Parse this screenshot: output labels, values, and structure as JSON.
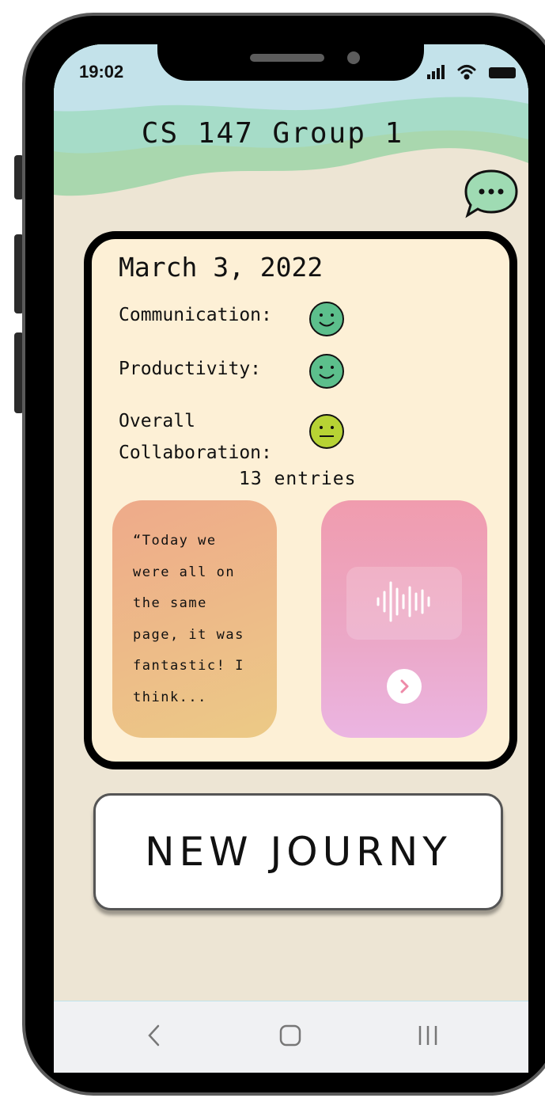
{
  "status_bar": {
    "time": "19:02"
  },
  "header": {
    "title": "CS 147 Group 1"
  },
  "icons": {
    "chat": "chat-bubble-icon",
    "happy": "happy-face-icon",
    "neutral": "neutral-face-icon",
    "audio": "audio-waveform-icon",
    "play": "play-icon",
    "back": "back-icon",
    "home": "home-icon",
    "recents": "recents-icon"
  },
  "entry": {
    "date": "March 3, 2022",
    "metrics": [
      {
        "label": "Communication:",
        "mood": "happy",
        "color": "#5cbf8c"
      },
      {
        "label": "Productivity:",
        "mood": "happy",
        "color": "#5cbf8c"
      },
      {
        "label": "Overall\nCollaboration:",
        "mood": "neutral",
        "color": "#b7d334"
      }
    ],
    "count": "13 entries",
    "quote": "“Today we\nwere all on\nthe same\npage, it was\nfantastic! I\nthink..."
  },
  "actions": {
    "new_journey": "NEW JOURNY"
  },
  "colors": {
    "background": "#ede5d4",
    "card": "#fdf0d6",
    "accent_green": "#5cbf8c",
    "accent_yellow": "#b7d334",
    "quote_gradient": [
      "#eeaa8a",
      "#ecca86"
    ],
    "audio_gradient": [
      "#f09cae",
      "#ebb5e2"
    ]
  }
}
